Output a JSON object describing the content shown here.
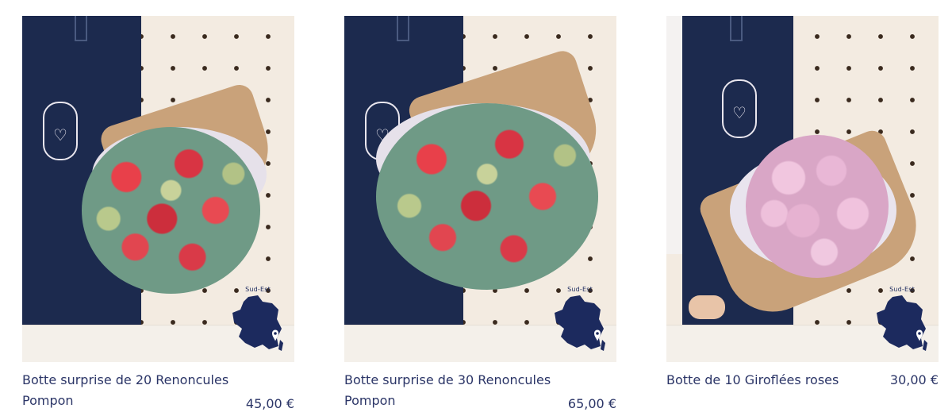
{
  "products": [
    {
      "name": "Botte surprise de 20 Renoncules Pompon",
      "price": "45,00 €",
      "region": "Sud-Est"
    },
    {
      "name": "Botte surprise de 30 Renoncules Pompon",
      "price": "65,00 €",
      "region": "Sud-Est"
    },
    {
      "name": "Botte de 10 Giroflées roses",
      "price": "30,00 €",
      "region": "Sud-Est"
    }
  ],
  "icons": {
    "region_map": "france-map-icon",
    "location_pin": "location-pin-icon"
  },
  "colors": {
    "text": "#2b3567",
    "map_blue": "#1c2a5e",
    "apron": "#1c2a4e"
  }
}
